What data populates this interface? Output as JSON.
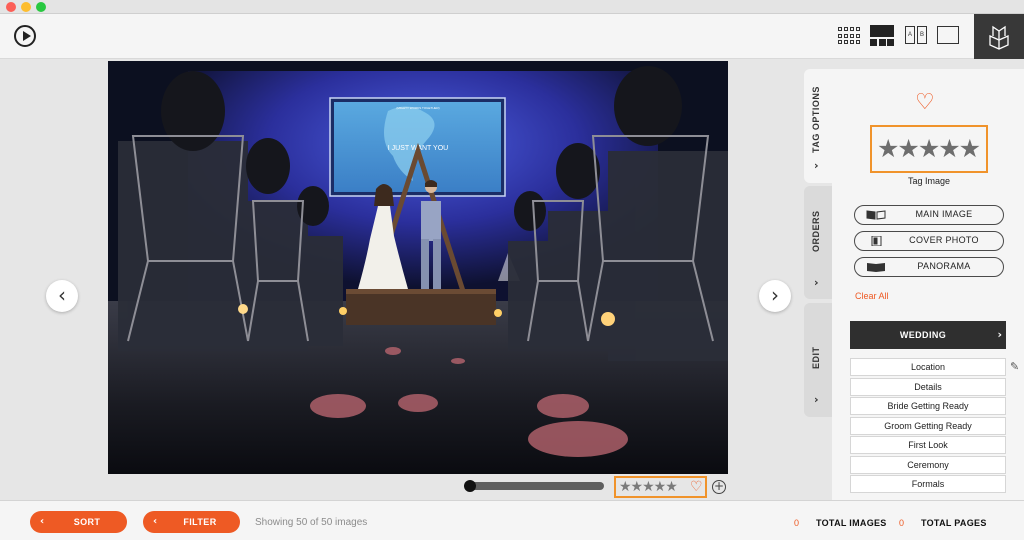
{
  "toolbar": {
    "play_icon": "play-circle-icon",
    "views": [
      "grid-view-icon",
      "filmstrip-view-icon",
      "compare-view-icon",
      "single-view-icon"
    ],
    "compare_a": "A",
    "compare_b": "B",
    "book_icon": "book-icon"
  },
  "photo": {
    "screen_text": "I JUST WANT YOU",
    "screen_subtitle": "(MIGHTY WORDS TOGETHER)"
  },
  "viewer": {
    "prev_glyph": "‹",
    "next_glyph": "›",
    "stars": "★★★★★",
    "heart": "♡",
    "plus": "+"
  },
  "side_tabs": [
    {
      "label": "TAG OPTIONS",
      "chevron": "›"
    },
    {
      "label": "ORDERS",
      "chevron": "›"
    },
    {
      "label": "EDIT",
      "chevron": "›"
    }
  ],
  "panel": {
    "heart": "♡",
    "stars": "★★★★★",
    "tag_image_label": "Tag Image",
    "buttons": [
      "MAIN IMAGE",
      "COVER PHOTO",
      "PANORAMA"
    ],
    "clear_all": "Clear All",
    "album": {
      "label": "WEDDING",
      "chevron": "›"
    },
    "categories": [
      "Location",
      "Details",
      "Bride Getting Ready",
      "Groom Getting Ready",
      "First Look",
      "Ceremony",
      "Formals"
    ],
    "edit_icon": "pencil-icon"
  },
  "bottom": {
    "sort": {
      "label": "SORT",
      "chevron": "‹"
    },
    "filter": {
      "label": "FILTER",
      "chevron": "‹"
    },
    "showing": "Showing 50 of 50 images",
    "total_images_count": "0",
    "total_images_label": "TOTAL IMAGES",
    "total_pages_count": "0",
    "total_pages_label": "TOTAL PAGES"
  },
  "colors": {
    "accent": "#ee5a24",
    "highlight": "#f0932b",
    "dark": "#2f2f2f"
  }
}
